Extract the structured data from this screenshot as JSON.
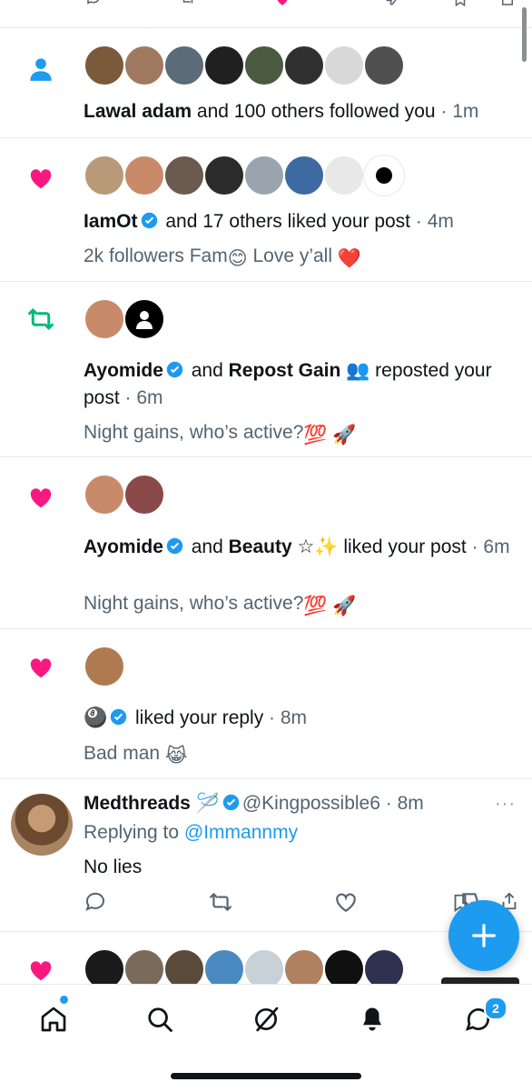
{
  "colors": {
    "accent": "#1d9bf0",
    "like": "#f91880",
    "repost": "#00ba7c",
    "text": "#0f1419",
    "muted": "#536471"
  },
  "notifications": [
    {
      "type": "follow",
      "icon": "person-icon",
      "actor": "Lawal adam",
      "rest": " and 100 others followed you",
      "time": " · 1m",
      "avatars": [
        "#7a5a3a",
        "#a07860",
        "#5b6b78",
        "#202020",
        "#4a5a40",
        "#303030",
        "#d8d8d8",
        "#505050"
      ]
    },
    {
      "type": "like",
      "icon": "heart-icon",
      "actor": "IamOt",
      "rest": " and 17 others liked your post",
      "time": " · 4m",
      "snippet_text": "2k followers Fam",
      "snippet_emoji": "😊",
      "snippet_text2": " Love y’all ",
      "snippet_emoji2": "❤️",
      "avatars": [
        "#b89a78",
        "#c98a6a",
        "#6a5a50",
        "#2b2b2b",
        "#9aa4ae",
        "#3d6aa0",
        "#e8e8e8",
        "#000000"
      ]
    },
    {
      "type": "repost",
      "icon": "repost-icon",
      "actor": "Ayomide",
      "mid": " and ",
      "actor2": "Repost Gain",
      "actor2_emoji": " 👥",
      "rest": " reposted your post",
      "time": " · 6m",
      "snippet_text": "Night gains, who’s active?",
      "snippet_emoji": "💯 🚀",
      "avatars": [
        "#c98a6a",
        "#000000"
      ]
    },
    {
      "type": "like",
      "icon": "heart-icon",
      "actor": "Ayomide",
      "mid": " and ",
      "actor2": "Beauty",
      "actor2_emoji": " ☆✨",
      "rest": " liked your post",
      "time": " · 6m",
      "snippet_text": "Night gains, who’s active?",
      "snippet_emoji": "💯 🚀",
      "avatars": [
        "#c98a6a",
        "#8a4a4a"
      ]
    },
    {
      "type": "like",
      "icon": "heart-icon",
      "actor": "🎱",
      "rest": " liked your reply",
      "time": " · 8m",
      "snippet_text": "Bad man ",
      "snippet_emoji": "😹",
      "avatars": [
        "#b07a50"
      ]
    }
  ],
  "reply": {
    "name": "Medthreads",
    "name_emoji": " 🪡",
    "handle": "@Kingpossible6",
    "time": " · 8m",
    "replying_prefix": "Replying to ",
    "replying_to": "@Immannmy",
    "text": "No lies",
    "more": "···"
  },
  "partial_row_avatars": [
    "#1a1a1a",
    "#7a6a5a",
    "#5a4a3a",
    "#4a8ac0",
    "#c8d0d8",
    "#b08060",
    "#101010",
    "#303050"
  ],
  "tabs": {
    "messages_badge": "2"
  }
}
